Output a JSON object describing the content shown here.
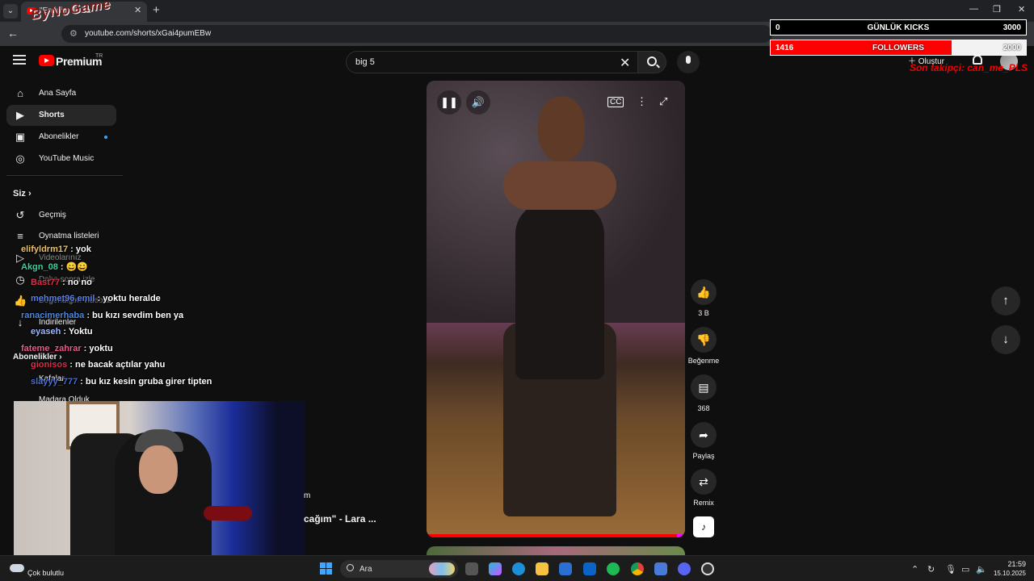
{
  "browser": {
    "tab_title": "\"Eminim ilk ba",
    "url": "youtube.com/shorts/xGai4pumEBw",
    "logo_overlay_text": "ByNoGame"
  },
  "masthead": {
    "brand": "Premium",
    "region": "TR",
    "search_value": "big 5",
    "create_label": "Oluştur"
  },
  "overlay": {
    "kicks_value": "0",
    "kicks_label": "GÜNLÜK KICKS",
    "kicks_goal": "3000",
    "followers_value": "1416",
    "followers_label": "FOLLOWERS",
    "followers_goal": "2000",
    "followers_progress": 0.708,
    "last_follower": "Son takipçi: can_me_PLS"
  },
  "sidebar": {
    "items": [
      {
        "label": "Ana Sayfa",
        "icon": "home-icon"
      },
      {
        "label": "Shorts",
        "icon": "shorts-icon"
      },
      {
        "label": "Abonelikler",
        "icon": "subscriptions-icon"
      },
      {
        "label": "YouTube Music",
        "icon": "music-icon"
      }
    ],
    "section_you": "Siz",
    "you_items": [
      {
        "label": "Geçmiş",
        "icon": "history-icon"
      },
      {
        "label": "Oynatma listeleri",
        "icon": "playlists-icon"
      },
      {
        "label": "Videolarınız",
        "icon": "your-videos-icon"
      },
      {
        "label": "Daha sonra izle",
        "icon": "watch-later-icon"
      },
      {
        "label": "Beğendiğim videolar",
        "icon": "liked-icon"
      },
      {
        "label": "İndirilenler",
        "icon": "downloads-icon"
      }
    ],
    "subscriptions_header": "Abonelikler",
    "subscription_items": [
      {
        "label": "Kafalar"
      },
      {
        "label": "Madara Olduk"
      }
    ]
  },
  "chat": [
    {
      "user": "elifyldrm17",
      "message": "yok",
      "color": "#e8c16a"
    },
    {
      "user": "Akgn_08",
      "message": "😄😄",
      "color": "#37d4a2"
    },
    {
      "user": "Bast77",
      "message": "no no",
      "color": "#e0304a"
    },
    {
      "user": "mehmet96.emil",
      "message": "yoktu heralde",
      "color": "#5b7ee5"
    },
    {
      "user": "ranacimerhaba",
      "message": "bu kızı sevdim ben ya",
      "color": "#4a88e0"
    },
    {
      "user": "eyaseh",
      "message": "Yoktu",
      "color": "#9bb7ff"
    },
    {
      "user": "fateme_zahrar",
      "message": "yoktu",
      "color": "#e85a8a"
    },
    {
      "user": "gionisos",
      "message": "ne bacak açtılar yahu",
      "color": "#e02a4a"
    },
    {
      "user": "slayyy_777",
      "message": "bu kız kesin gruba girer tipten",
      "color": "#4a6fd8"
    }
  ],
  "video": {
    "progress": 0.97,
    "partial_title": "cağım\" - Lara ...",
    "partial_meta": "m"
  },
  "actions": {
    "like_count": "3 B",
    "dislike_label": "Beğenme",
    "comment_count": "368",
    "share_label": "Paylaş",
    "remix_label": "Remix"
  },
  "taskbar": {
    "weather": "Çok bulutlu",
    "search_placeholder": "Ara",
    "time": "21:59",
    "date": "15.10.2025"
  }
}
